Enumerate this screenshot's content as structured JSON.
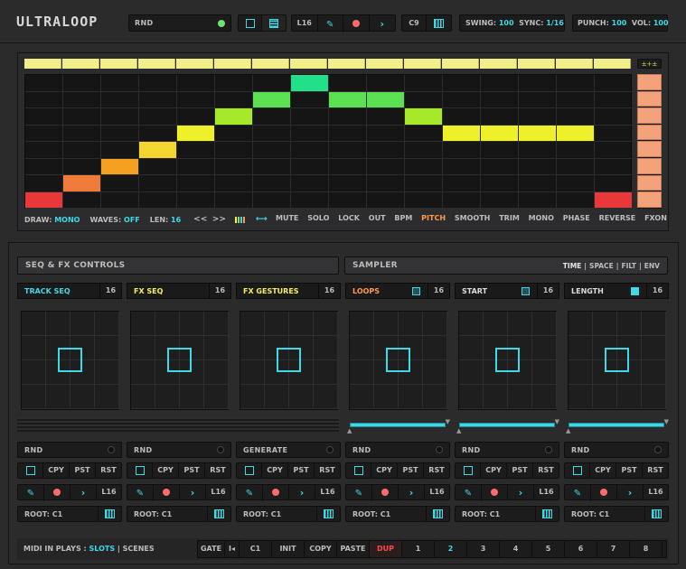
{
  "header": {
    "logo": "ULTRALOOP",
    "rnd_label": "RND",
    "len_label": "L16",
    "note_label": "C9",
    "swing_label": "SWING:",
    "swing_value": "100",
    "sync_label": "SYNC:",
    "sync_value": "1/16",
    "punch_label": "PUNCH:",
    "punch_value": "100",
    "vol_label": "VOL:",
    "vol_value": "100"
  },
  "sequencer": {
    "fx_badge": "±+±",
    "draw_label": "DRAW:",
    "draw_value": "MONO",
    "waves_label": "WAVES:",
    "waves_value": "OFF",
    "len_label": "LEN:",
    "len_value": "16",
    "prev_label": "<<",
    "next_label": ">>",
    "steps": [
      1,
      2,
      3,
      4,
      5,
      6,
      7,
      8,
      7,
      7,
      6,
      5,
      5,
      5,
      5,
      1
    ],
    "step_colors": [
      "#e8383a",
      "#f07a3a",
      "#f5a020",
      "#f5d530",
      "#eef02a",
      "#a8e82a",
      "#5ae050",
      "#22e08a",
      "#5ae050",
      "#5ae050",
      "#a8e82a",
      "#eef02a",
      "#eef02a",
      "#eef02a",
      "#eef02a",
      "#e8383a"
    ],
    "modes": [
      "MUTE",
      "SOLO",
      "LOCK",
      "OUT",
      "BPM",
      "PITCH",
      "SMOOTH",
      "TRIM",
      "MONO",
      "PHASE",
      "REVERSE",
      "FXON"
    ],
    "active_mode": "PITCH"
  },
  "sections": {
    "seqfx_title": "SEQ & FX CONTROLS",
    "sampler_title": "SAMPLER",
    "sampler_tabs": [
      "TIME",
      "SPACE",
      "FILT",
      "ENV"
    ],
    "tab_sep": "|"
  },
  "columns": [
    {
      "title": "TRACK SEQ",
      "color": "#3fd8e6",
      "steps": "16",
      "mode": "RND",
      "slider": false
    },
    {
      "title": "FX SEQ",
      "color": "#f7ee5a",
      "steps": "16",
      "mode": "RND",
      "slider": false
    },
    {
      "title": "FX GESTURES",
      "color": "#f7ee5a",
      "steps": "16",
      "mode": "GENERATE",
      "slider": false
    },
    {
      "title": "LOOPS",
      "color": "#ff9a4a",
      "steps": "16",
      "mode": "RND",
      "slider": true
    },
    {
      "title": "START",
      "color": "#dcdcdc",
      "steps": "16",
      "mode": "RND",
      "slider": true
    },
    {
      "title": "LENGTH",
      "color": "#dcdcdc",
      "steps": "16",
      "mode": "RND",
      "slider": true
    }
  ],
  "column_controls": {
    "cpy": "CPY",
    "pst": "PST",
    "rst": "RST",
    "len": "L16",
    "root_label": "ROOT:",
    "root_value": "C1"
  },
  "footer": {
    "midi_label": "MIDI IN PLAYS :",
    "slots": "SLOTS",
    "sep": "|",
    "scenes": "SCENES",
    "gate": "GATE",
    "first": "I◂",
    "note": "C1",
    "init": "INIT",
    "copy": "COPY",
    "paste": "PASTE",
    "dup": "DUP",
    "slots_list": [
      "1",
      "2",
      "3",
      "4",
      "5",
      "6",
      "7",
      "8"
    ],
    "active_slot": "2"
  },
  "colors": {
    "accent": "#3fd8e6",
    "yellow": "#f7ee5a",
    "orange": "#ff9a4a",
    "dup_red": "#ff4a4a"
  }
}
